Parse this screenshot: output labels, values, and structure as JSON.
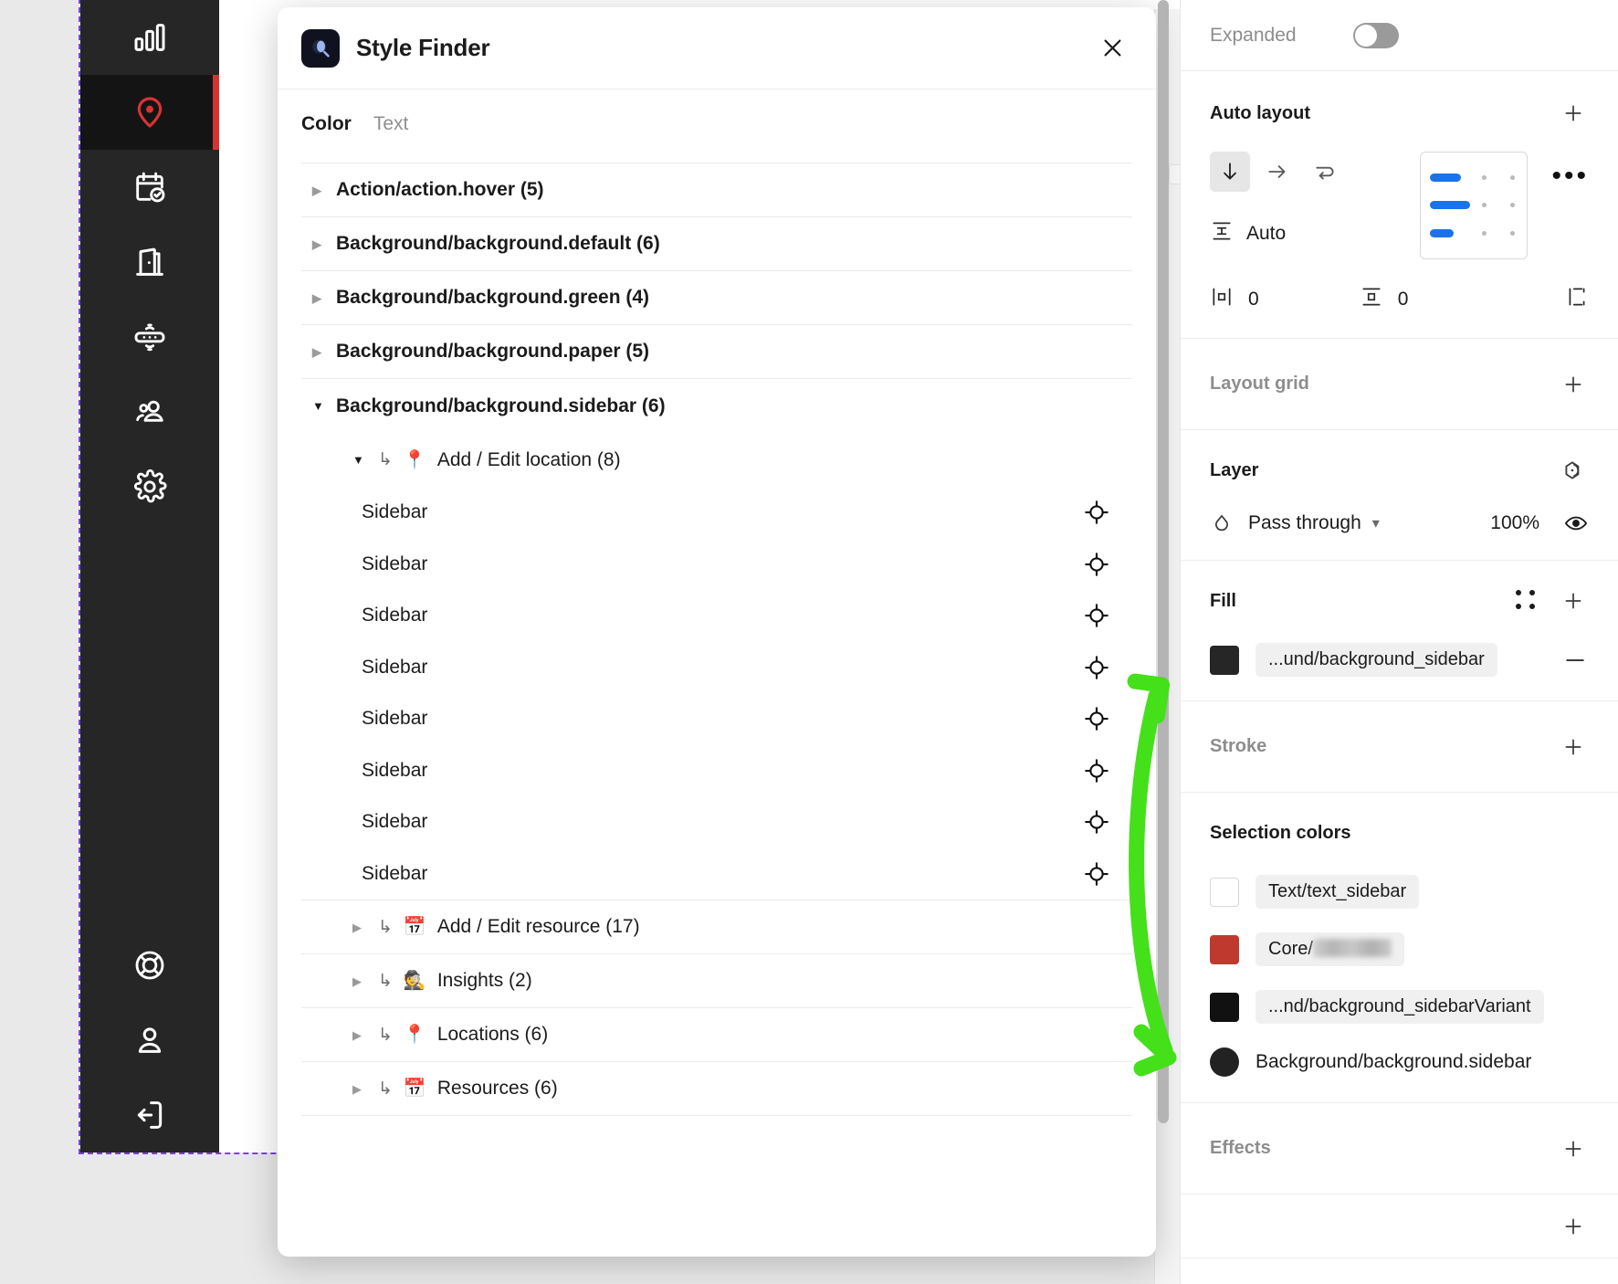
{
  "sidebar": {
    "items": [
      {
        "name": "analytics",
        "icon": "bar-chart-icon",
        "active": false
      },
      {
        "name": "locations",
        "icon": "location-pin-icon",
        "active": true
      },
      {
        "name": "bookings",
        "icon": "calendar-check-icon",
        "active": false
      },
      {
        "name": "rooms",
        "icon": "door-icon",
        "active": false
      },
      {
        "name": "sensors",
        "icon": "sensor-icon",
        "active": false
      },
      {
        "name": "people",
        "icon": "people-icon",
        "active": false
      },
      {
        "name": "settings",
        "icon": "gear-icon",
        "active": false
      }
    ],
    "bottom_items": [
      {
        "name": "help",
        "icon": "lifebuoy-icon"
      },
      {
        "name": "account",
        "icon": "user-icon"
      },
      {
        "name": "logout",
        "icon": "logout-icon"
      }
    ],
    "active_accent": "#d83333"
  },
  "dialog": {
    "title": "Style Finder",
    "logo_icon": "style-finder-logo",
    "close_icon": "close-icon",
    "tabs": [
      {
        "label": "Color",
        "active": true
      },
      {
        "label": "Text",
        "active": false
      }
    ],
    "groups": [
      {
        "label": "Action/action.hover (5)",
        "expanded": false
      },
      {
        "label": "Background/background.default (6)",
        "expanded": false
      },
      {
        "label": "Background/background.green (4)",
        "expanded": false
      },
      {
        "label": "Background/background.paper (5)",
        "expanded": false
      },
      {
        "label": "Background/background.sidebar (6)",
        "expanded": true
      }
    ],
    "children": [
      {
        "emoji": "📍",
        "label": "Add / Edit location (8)",
        "expanded": true,
        "leaves": [
          "Sidebar",
          "Sidebar",
          "Sidebar",
          "Sidebar",
          "Sidebar",
          "Sidebar",
          "Sidebar",
          "Sidebar"
        ],
        "leaf_icon": "target-icon"
      },
      {
        "emoji": "📅",
        "label": "Add / Edit resource (17)",
        "expanded": false,
        "leaves": [],
        "leaf_icon": "target-icon"
      },
      {
        "emoji": "🕵️",
        "label": "Insights (2)",
        "expanded": false,
        "leaves": [],
        "leaf_icon": "target-icon"
      },
      {
        "emoji": "📍",
        "label": "Locations (6)",
        "expanded": false,
        "leaves": [],
        "leaf_icon": "target-icon"
      },
      {
        "emoji": "📅",
        "label": "Resources (6)",
        "expanded": false,
        "leaves": [],
        "leaf_icon": "target-icon"
      }
    ]
  },
  "panel": {
    "expanded": {
      "label": "Expanded",
      "on": false
    },
    "auto_layout": {
      "title": "Auto layout",
      "add_icon": "plus-icon",
      "directions": [
        {
          "name": "vertical",
          "icon": "arrow-down-icon",
          "selected": true
        },
        {
          "name": "horizontal",
          "icon": "arrow-right-icon",
          "selected": false
        },
        {
          "name": "wrap",
          "icon": "wrap-icon",
          "selected": false
        }
      ],
      "spacing_label": "Auto",
      "spacing_icon": "spacing-icon",
      "horizontal_padding": "0",
      "vertical_padding": "0",
      "more_icon": "more-horizontal-icon",
      "alignment_grid": {
        "selected_row": 0,
        "selected_col": 0
      },
      "grid_bar_color": "#1a73e8"
    },
    "layout_grid": {
      "title": "Layout grid",
      "add_icon": "plus-icon"
    },
    "layer": {
      "title": "Layer",
      "mask_icon": "mask-icon",
      "blend_icon": "blend-mode-icon",
      "blend_mode": "Pass through",
      "chevron_icon": "chevron-down-icon",
      "opacity": "100%",
      "visibility_icon": "eye-icon"
    },
    "fill": {
      "title": "Fill",
      "styles_icon": "four-dots-icon",
      "add_icon": "plus-icon",
      "items": [
        {
          "color": "#262626",
          "label": "...und/background_sidebar",
          "remove_icon": "minus-icon"
        }
      ]
    },
    "stroke": {
      "title": "Stroke",
      "add_icon": "plus-icon"
    },
    "selection_colors": {
      "title": "Selection colors",
      "items": [
        {
          "color": "#ffffff",
          "label": "Text/text_sidebar",
          "chip": true,
          "shape": "square",
          "redacted": false
        },
        {
          "color": "#c0392f",
          "label": "Core/",
          "chip": true,
          "shape": "square",
          "redacted": true
        },
        {
          "color": "#111111",
          "label": "...nd/background_sidebarVariant",
          "chip": true,
          "shape": "square",
          "redacted": false
        },
        {
          "color": "#222222",
          "label": "Background/background.sidebar",
          "chip": false,
          "shape": "circle",
          "redacted": false
        }
      ]
    },
    "effects": {
      "title": "Effects",
      "add_icon": "plus-icon"
    }
  },
  "annotation": {
    "type": "double-headed-curved-arrow",
    "color": "#44e01a"
  }
}
